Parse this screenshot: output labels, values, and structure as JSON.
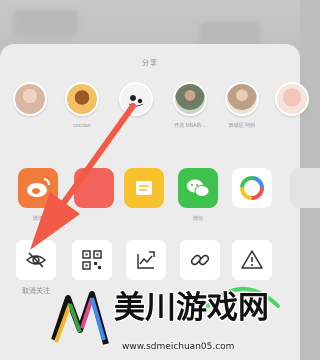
{
  "sheet": {
    "title": "分享"
  },
  "contacts": [
    {
      "name": "",
      "color": "#d9b7a3",
      "ring": "#e9d8cf"
    },
    {
      "name": "cocolan",
      "color": "#c98a2e",
      "ring": "#f3c065"
    },
    {
      "name": "",
      "color": "#f3f3f3",
      "ring": "#ffffff"
    },
    {
      "name": "开店 MBA的...",
      "color": "#6d7d66",
      "ring": "#c9d7c2"
    },
    {
      "name": "西城区 阿娇",
      "color": "#b9a087",
      "ring": "#eee2d3"
    },
    {
      "name": "",
      "color": "#f0c7ba",
      "ring": "#f7e3dc"
    }
  ],
  "apps": [
    {
      "label": "微博",
      "icon": "weibo-icon",
      "color": "#f27a3a"
    },
    {
      "label": "",
      "icon": "red-app-icon",
      "color": "#f2645a"
    },
    {
      "label": "",
      "icon": "note-icon",
      "color": "#f7c22e"
    },
    {
      "label": "微信",
      "icon": "wechat-icon",
      "color": "#3ec24d"
    },
    {
      "label": "",
      "icon": "colorful-app-icon",
      "color": "#ffffff"
    },
    {
      "label": "",
      "icon": "partial-app-icon",
      "color": "#e8e8e8"
    }
  ],
  "functions": [
    {
      "label": "取消关注",
      "icon": "eye-slash-icon"
    },
    {
      "label": "",
      "icon": "qr-code-icon"
    },
    {
      "label": "",
      "icon": "share-chart-icon"
    },
    {
      "label": "",
      "icon": "link-icon"
    },
    {
      "label": "",
      "icon": "warning-icon"
    }
  ],
  "watermark": {
    "title": "美川游戏网",
    "url": "www.sdmeichuan05.com"
  },
  "colors": {
    "arrow": "#f05a47",
    "sheet_bg": "#ececec"
  }
}
